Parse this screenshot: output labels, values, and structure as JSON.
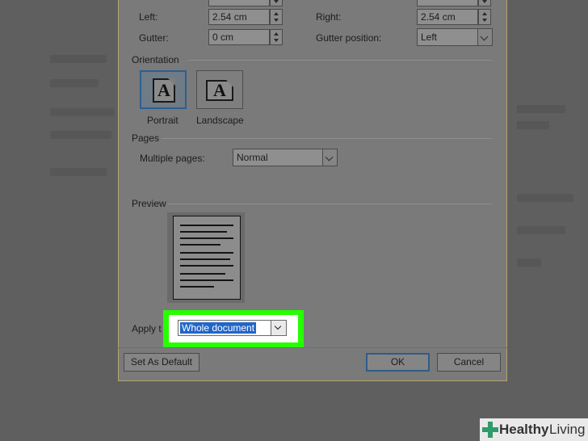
{
  "margins": {
    "left_label": "Left:",
    "left_value": "2.54 cm",
    "right_label": "Right:",
    "right_value": "2.54 cm",
    "gutter_label": "Gutter:",
    "gutter_value": "0 cm",
    "gutter_position_label": "Gutter position:",
    "gutter_position_value": "Left"
  },
  "orientation": {
    "section_label": "Orientation",
    "portrait_label": "Portrait",
    "landscape_label": "Landscape",
    "icon_letter": "A",
    "selected": "portrait"
  },
  "pages": {
    "section_label": "Pages",
    "multiple_pages_label": "Multiple pages:",
    "multiple_pages_value": "Normal"
  },
  "preview": {
    "section_label": "Preview"
  },
  "apply_to": {
    "label": "Apply t",
    "value": "Whole document"
  },
  "buttons": {
    "set_as_default": "Set As Default",
    "ok": "OK",
    "cancel": "Cancel"
  },
  "brand": {
    "part1": "Healthy",
    "part2": "Living",
    "color": "#2f9b6a"
  },
  "highlight_color": "#26ff00"
}
